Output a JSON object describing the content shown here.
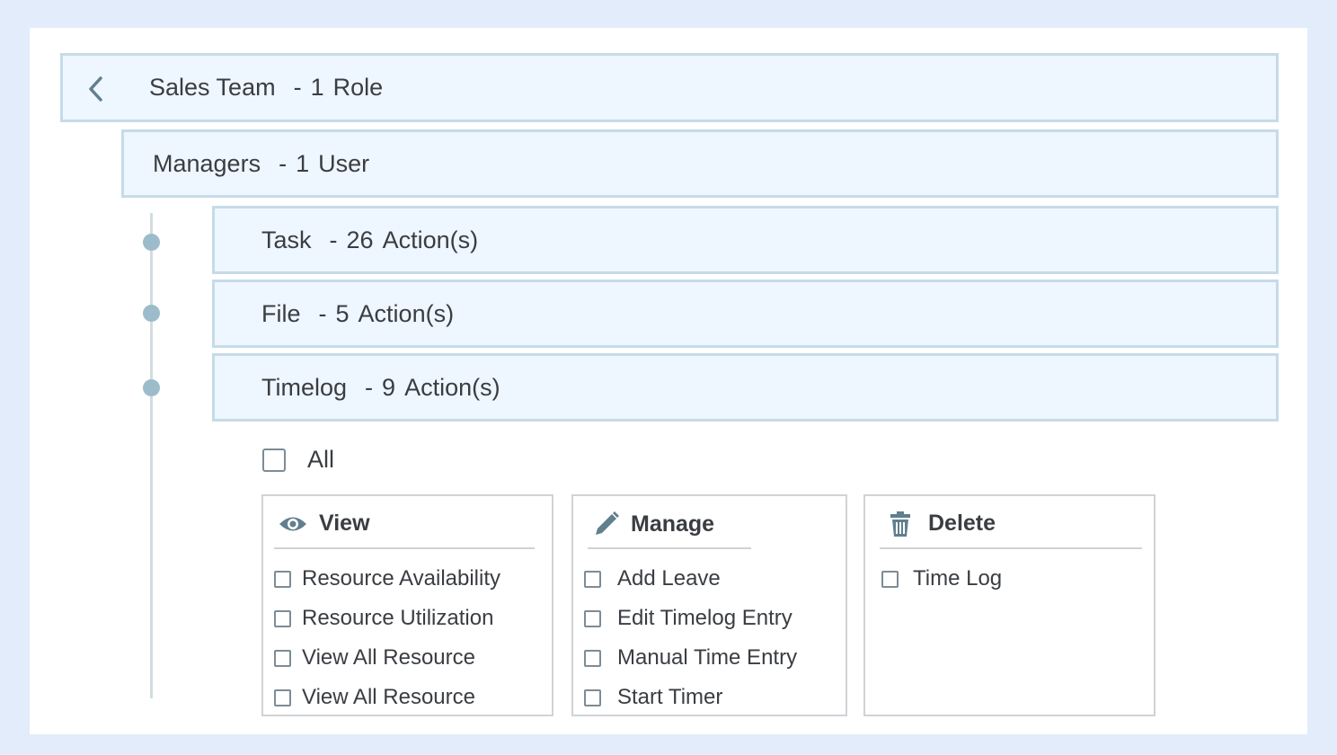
{
  "team": {
    "name": "Sales Team",
    "separator": "-",
    "count": "1",
    "unit": "Role"
  },
  "group": {
    "name": "Managers",
    "separator": "-",
    "count": "1",
    "unit": "User"
  },
  "modules": [
    {
      "name": "Task",
      "separator": "-",
      "count": "26",
      "unit": "Action(s)"
    },
    {
      "name": "File",
      "separator": "-",
      "count": "5",
      "unit": "Action(s)"
    },
    {
      "name": "Timelog",
      "separator": "-",
      "count": "9",
      "unit": "Action(s)"
    }
  ],
  "all_label": "All",
  "panels": {
    "view": {
      "title": "View",
      "icon": "eye-icon",
      "items": [
        "Resource Availability",
        "Resource Utilization",
        "View All Resource",
        "View All Resource"
      ]
    },
    "manage": {
      "title": "Manage",
      "icon": "pencil-icon",
      "items": [
        "Add Leave",
        "Edit Timelog Entry",
        "Manual Time Entry",
        "Start Timer"
      ]
    },
    "delete": {
      "title": "Delete",
      "icon": "trash-icon",
      "items": [
        "Time Log"
      ]
    }
  },
  "colors": {
    "background": "#e3ecfb",
    "bar_fill": "#eef6ff",
    "bar_border": "#c6dbe8",
    "timeline_dot": "#9cbccb",
    "icon": "#617f8e"
  }
}
